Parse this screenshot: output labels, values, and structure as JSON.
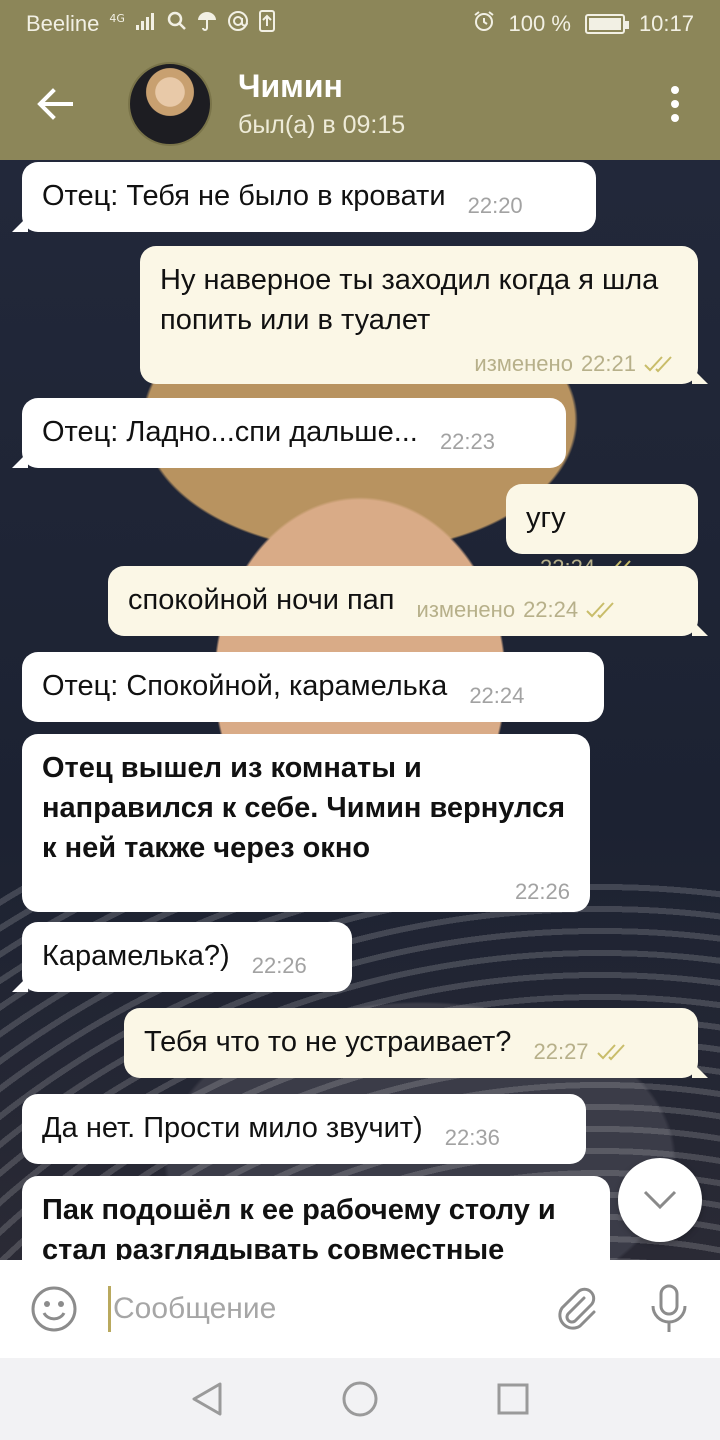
{
  "status_bar": {
    "carrier": "Beeline",
    "network": "4G",
    "battery": "100 %",
    "time": "10:17"
  },
  "header": {
    "contact_name": "Чимин",
    "last_seen": "был(а) в 09:15"
  },
  "messages": [
    {
      "direction": "in",
      "text": "Отец: Тебя не было в кровати",
      "time": "22:20"
    },
    {
      "direction": "out",
      "text": "Ну наверное ты заходил когда я шла попить или в туалет",
      "edited": "изменено",
      "time": "22:21",
      "read": true
    },
    {
      "direction": "in",
      "text": "Отец: Ладно...спи дальше...",
      "time": "22:23"
    },
    {
      "direction": "out",
      "text": "угу",
      "time": "22:24",
      "read": true
    },
    {
      "direction": "out",
      "text": "спокойной ночи пап",
      "edited": "изменено",
      "time": "22:24",
      "read": true
    },
    {
      "direction": "in",
      "text": "Отец: Спокойной, карамелька",
      "time": "22:24"
    },
    {
      "direction": "in",
      "text": "Отец вышел из комнаты и направился к себе. Чимин вернулся к ней также через окно",
      "time": "22:26",
      "bold": true
    },
    {
      "direction": "in",
      "text": "Карамелька?)",
      "time": "22:26"
    },
    {
      "direction": "out",
      "text": "Тебя что то не устраивает?",
      "time": "22:27",
      "read": true
    },
    {
      "direction": "in",
      "text": "Да нет. Прости мило звучит)",
      "time": "22:36"
    },
    {
      "direction": "in",
      "text": "Пак подошёл к ее рабочему столу и стал разглядывать совместные",
      "bold": true
    }
  ],
  "composer": {
    "placeholder": "Сообщение"
  },
  "icons": {
    "back": "arrow-left-icon",
    "menu": "more-vertical-icon",
    "emoji": "smile-icon",
    "attach": "paperclip-icon",
    "mic": "microphone-icon",
    "scroll_down": "chevron-down-icon"
  },
  "colors": {
    "header": "#8c8659",
    "outgoing_bubble": "#fbf7e6",
    "incoming_bubble": "#ffffff",
    "read_check": "#c9bd6a"
  }
}
